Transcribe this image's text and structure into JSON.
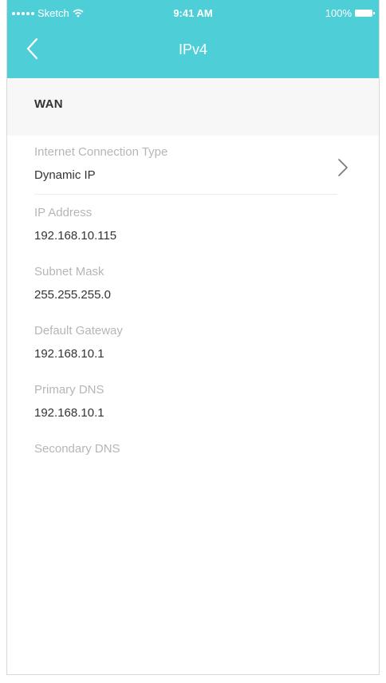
{
  "status_bar": {
    "carrier": "Sketch",
    "time": "9:41 AM",
    "battery": "100%"
  },
  "nav": {
    "title": "IPv4"
  },
  "section": {
    "title": "WAN"
  },
  "connection": {
    "label": "Internet Connection Type",
    "value": "Dynamic IP"
  },
  "fields": [
    {
      "label": "IP Address",
      "value": "192.168.10.115"
    },
    {
      "label": "Subnet Mask",
      "value": "255.255.255.0"
    },
    {
      "label": "Default Gateway",
      "value": "192.168.10.1"
    },
    {
      "label": "Primary DNS",
      "value": "192.168.10.1"
    },
    {
      "label": "Secondary DNS",
      "value": ""
    }
  ],
  "colors": {
    "header": "#4ecfd8",
    "section_bg": "#f7f7f7",
    "label": "#b6b6b6",
    "value": "#333333"
  },
  "icons": {
    "back": "chevron-left-icon",
    "disclosure": "chevron-right-icon",
    "wifi": "wifi-icon",
    "battery": "battery-icon"
  }
}
